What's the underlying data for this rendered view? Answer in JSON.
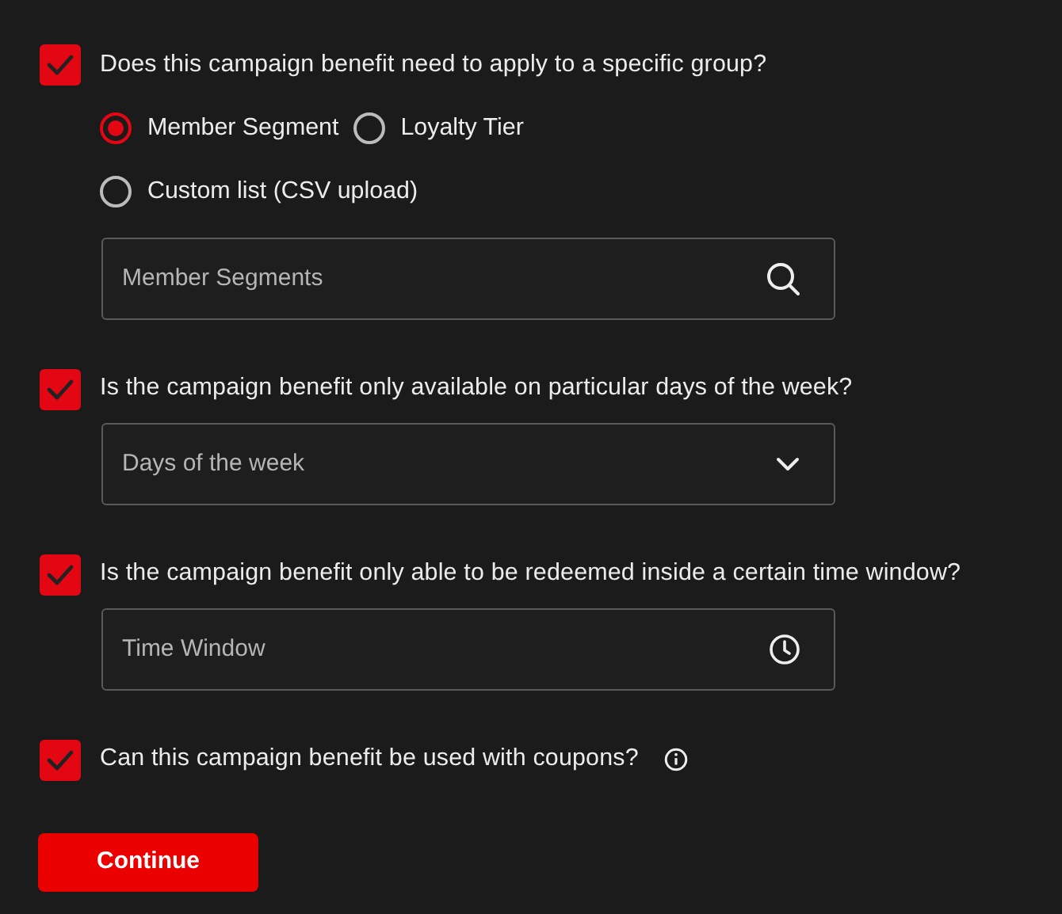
{
  "questions": [
    {
      "label": "Does this campaign benefit need to apply to a specific group?",
      "checked": true,
      "options": [
        {
          "label": "Member Segment",
          "selected": true
        },
        {
          "label": "Loyalty Tier",
          "selected": false
        },
        {
          "label": "Custom list (CSV upload)",
          "selected": false
        }
      ],
      "field": {
        "kind": "search",
        "placeholder": "Member Segments"
      }
    },
    {
      "label": "Is the campaign benefit only available on particular days of the week?",
      "checked": true,
      "field": {
        "kind": "select",
        "placeholder": "Days of the week"
      }
    },
    {
      "label": "Is the campaign benefit only able to be redeemed inside a certain time window?",
      "checked": true,
      "field": {
        "kind": "time",
        "placeholder": "Time Window"
      }
    },
    {
      "label": "Can this campaign benefit be used with coupons?",
      "checked": true,
      "info": true
    }
  ],
  "button": "Continue"
}
